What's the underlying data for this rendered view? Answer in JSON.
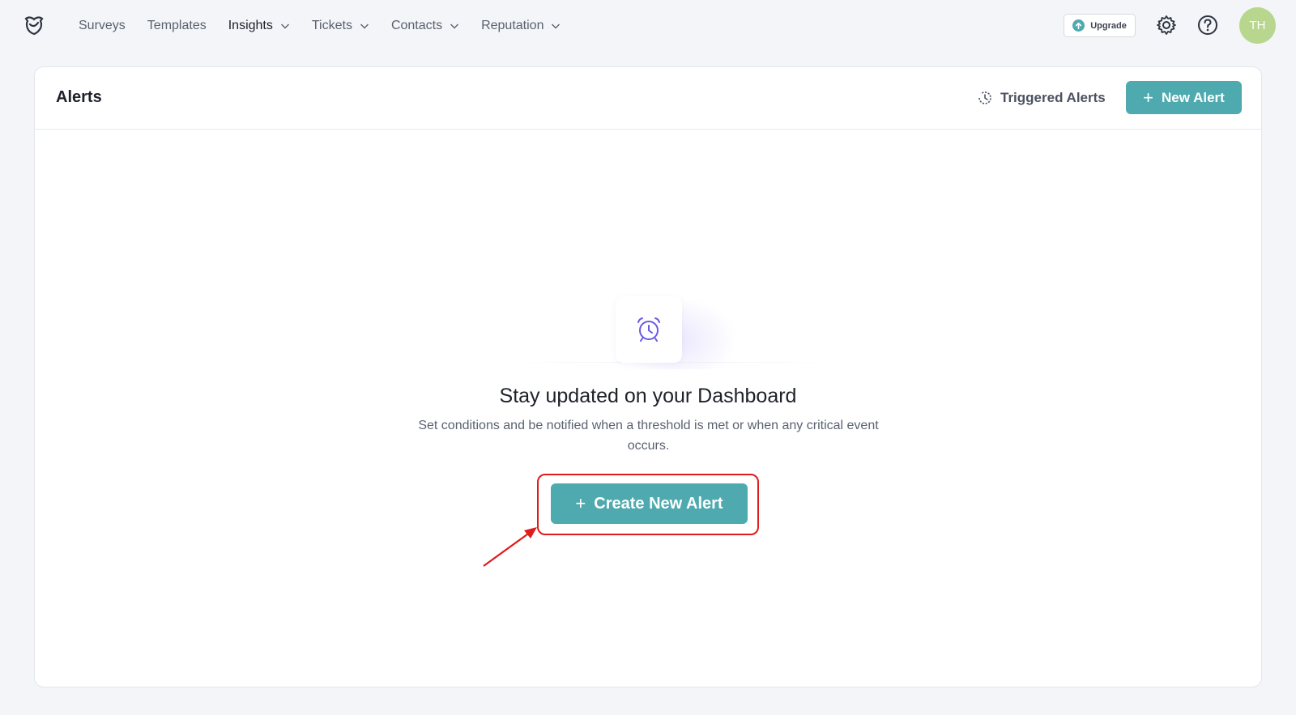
{
  "nav": {
    "items": [
      {
        "label": "Surveys",
        "dropdown": false,
        "active": false
      },
      {
        "label": "Templates",
        "dropdown": false,
        "active": false
      },
      {
        "label": "Insights",
        "dropdown": true,
        "active": true
      },
      {
        "label": "Tickets",
        "dropdown": true,
        "active": false
      },
      {
        "label": "Contacts",
        "dropdown": true,
        "active": false
      },
      {
        "label": "Reputation",
        "dropdown": true,
        "active": false
      }
    ]
  },
  "header": {
    "upgrade_label": "Upgrade",
    "avatar_initials": "TH"
  },
  "alerts": {
    "title": "Alerts",
    "triggered_label": "Triggered Alerts",
    "new_alert_label": "New Alert"
  },
  "empty_state": {
    "title": "Stay updated on your Dashboard",
    "subtitle": "Set conditions and be notified when a threshold is met or when any critical event occurs.",
    "cta_label": "Create New Alert"
  },
  "colors": {
    "accent": "#4faab0",
    "highlight": "#e01b1b",
    "avatar": "#b8d68e",
    "icon_purple": "#6a5ae0"
  }
}
